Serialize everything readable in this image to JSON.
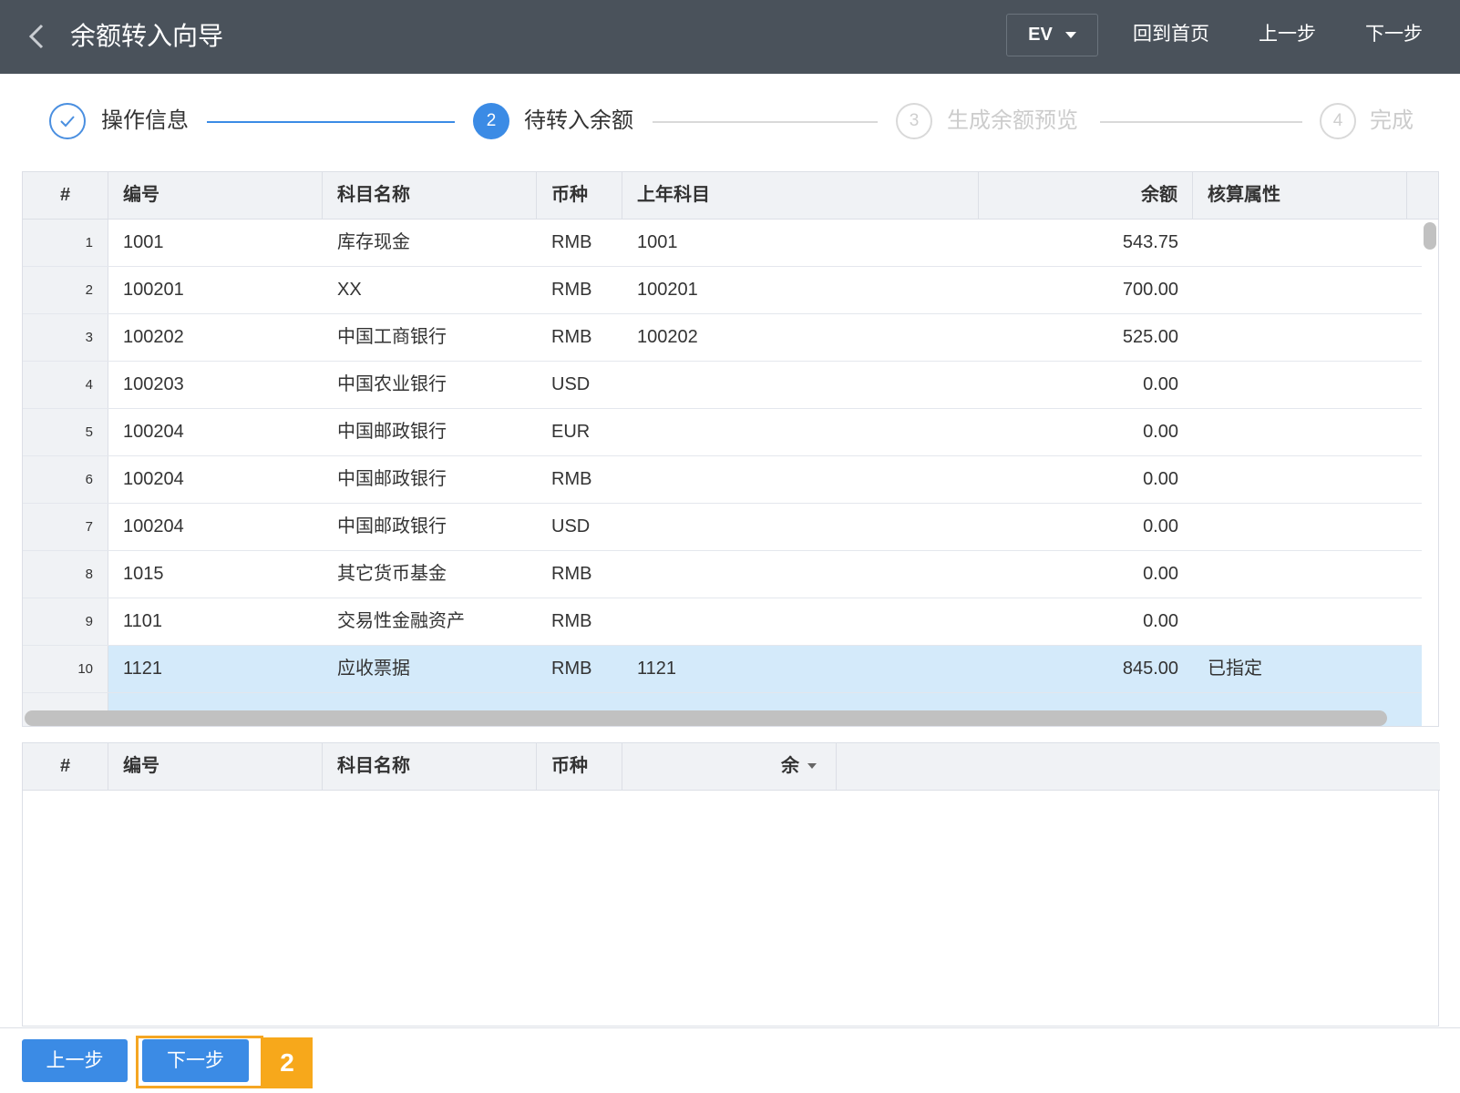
{
  "header": {
    "title": "余额转入向导",
    "ev_label": "EV",
    "home": "回到首页",
    "prev": "上一步",
    "next": "下一步"
  },
  "steps": [
    {
      "number": "✓",
      "label": "操作信息",
      "state": "done"
    },
    {
      "number": "2",
      "label": "待转入余额",
      "state": "active"
    },
    {
      "number": "3",
      "label": "生成余额预览",
      "state": "todo"
    },
    {
      "number": "4",
      "label": "完成",
      "state": "todo"
    }
  ],
  "table": {
    "headers": {
      "num": "#",
      "code": "编号",
      "name": "科目名称",
      "currency": "币种",
      "prev_subject": "上年科目",
      "balance": "余额",
      "attr": "核算属性"
    },
    "rows": [
      {
        "num": "1",
        "code": "1001",
        "name": "库存现金",
        "currency": "RMB",
        "prev_subject": "1001",
        "balance": "543.75",
        "attr": ""
      },
      {
        "num": "2",
        "code": "100201",
        "name": "XX",
        "currency": "RMB",
        "prev_subject": "100201",
        "balance": "700.00",
        "attr": ""
      },
      {
        "num": "3",
        "code": "100202",
        "name": "中国工商银行",
        "currency": "RMB",
        "prev_subject": "100202",
        "balance": "525.00",
        "attr": ""
      },
      {
        "num": "4",
        "code": "100203",
        "name": "中国农业银行",
        "currency": "USD",
        "prev_subject": "",
        "balance": "0.00",
        "attr": ""
      },
      {
        "num": "5",
        "code": "100204",
        "name": "中国邮政银行",
        "currency": "EUR",
        "prev_subject": "",
        "balance": "0.00",
        "attr": ""
      },
      {
        "num": "6",
        "code": "100204",
        "name": "中国邮政银行",
        "currency": "RMB",
        "prev_subject": "",
        "balance": "0.00",
        "attr": ""
      },
      {
        "num": "7",
        "code": "100204",
        "name": "中国邮政银行",
        "currency": "USD",
        "prev_subject": "",
        "balance": "0.00",
        "attr": ""
      },
      {
        "num": "8",
        "code": "1015",
        "name": "其它货币基金",
        "currency": "RMB",
        "prev_subject": "",
        "balance": "0.00",
        "attr": ""
      },
      {
        "num": "9",
        "code": "1101",
        "name": "交易性金融资产",
        "currency": "RMB",
        "prev_subject": "",
        "balance": "0.00",
        "attr": ""
      },
      {
        "num": "10",
        "code": "1121",
        "name": "应收票据",
        "currency": "RMB",
        "prev_subject": "1121",
        "balance": "845.00",
        "attr": "已指定",
        "selected": true
      }
    ]
  },
  "table2": {
    "headers": {
      "num": "#",
      "code": "编号",
      "name": "科目名称",
      "currency": "币种",
      "balance": "余"
    }
  },
  "footer": {
    "prev": "上一步",
    "next": "下一步",
    "marker": "2"
  },
  "colors": {
    "header_bg": "#4a525b",
    "accent": "#3b8be5",
    "selected_row": "#d4eafa",
    "highlight": "#f5a623"
  }
}
